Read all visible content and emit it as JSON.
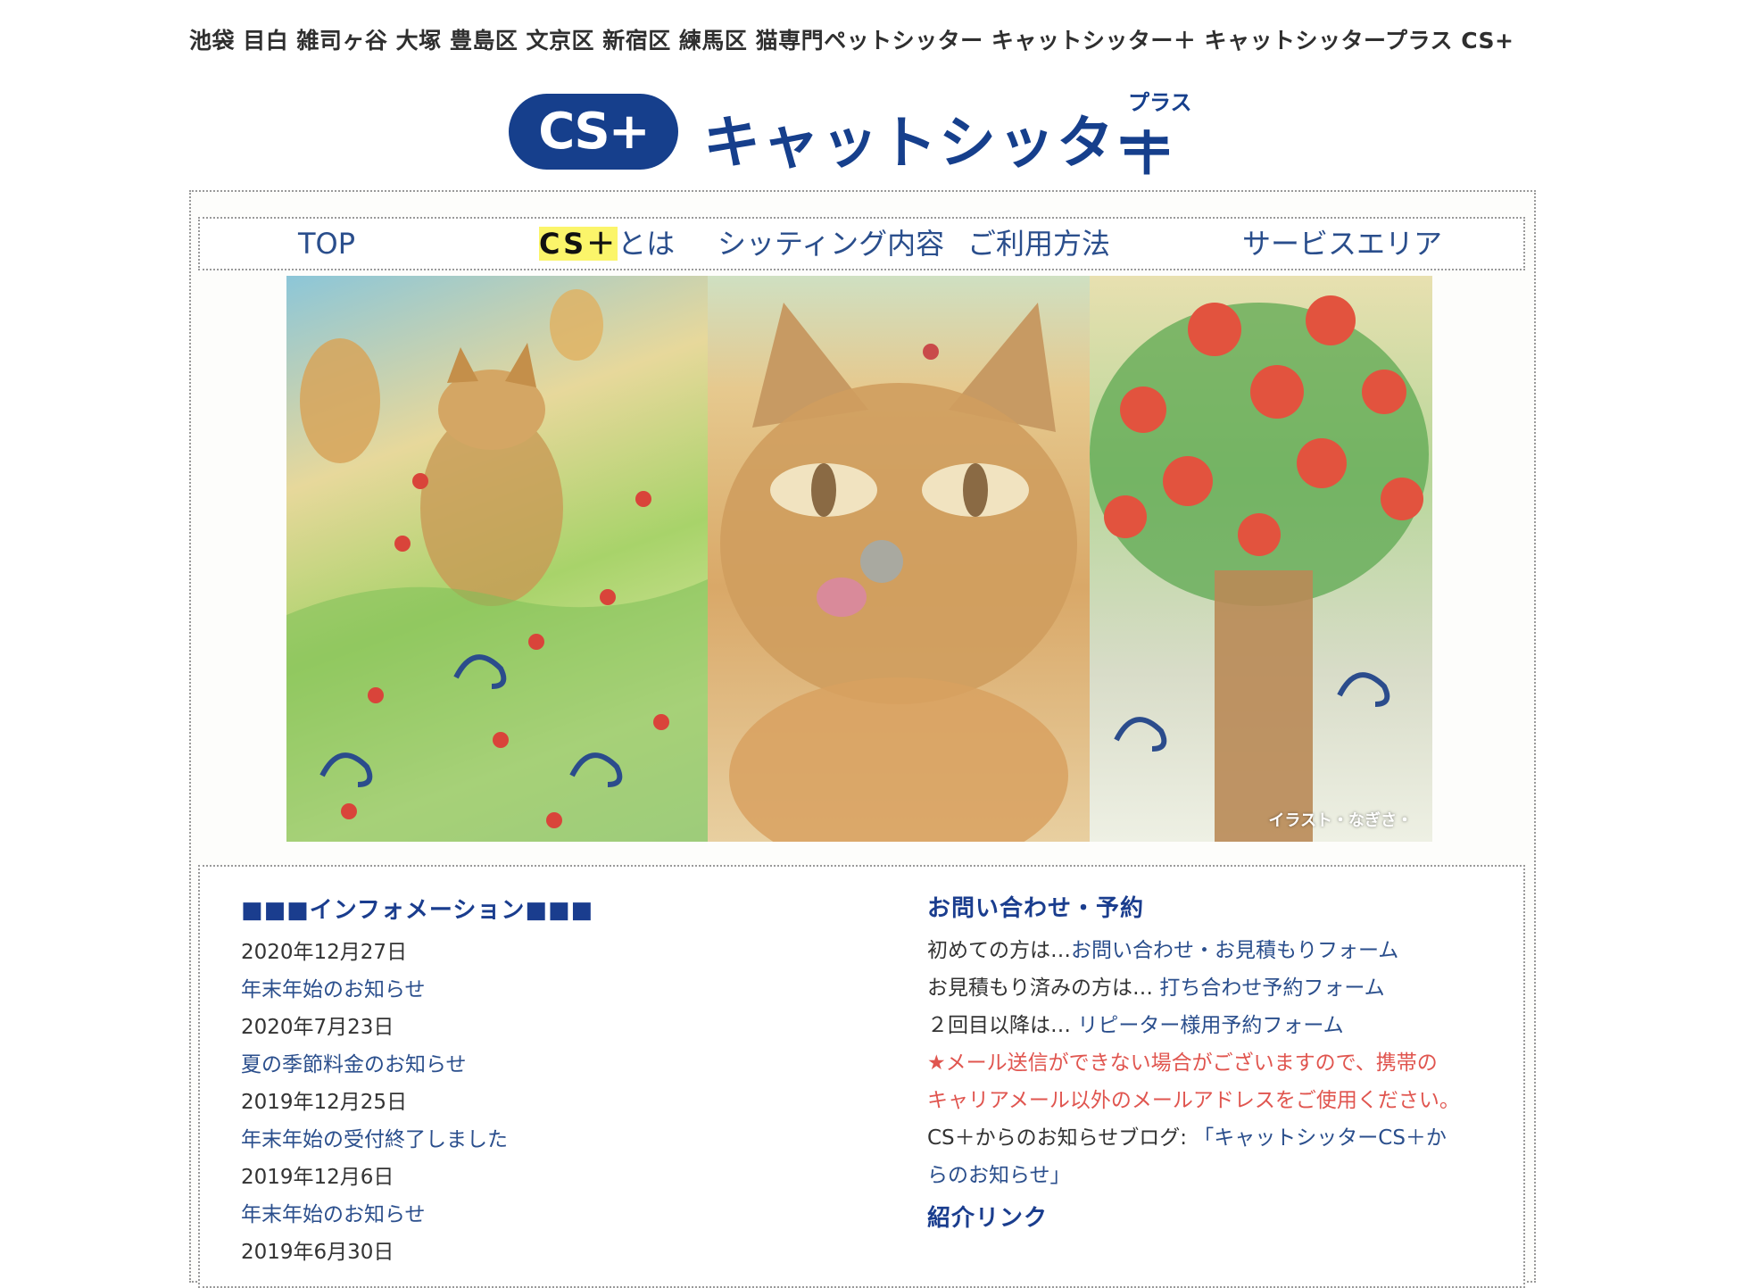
{
  "header": {
    "tagline": "池袋 目白 雑司ヶ谷 大塚 豊島区 文京区 新宿区 練馬区 猫専門ペットシッター キャットシッター＋ キャットシッタープラス CS+",
    "logo_mark": "CS+",
    "logo_text": "キャットシッター",
    "logo_plus": "＋",
    "logo_ruby": "プラス"
  },
  "nav": {
    "items": [
      {
        "label": "TOP"
      },
      {
        "label_hl": "CS＋",
        "label": "とは"
      },
      {
        "label": "シッティング内容"
      },
      {
        "label": "ご利用方法"
      },
      {
        "label": "サービスエリア"
      }
    ]
  },
  "hero": {
    "credit": "イラスト・なぎさ・"
  },
  "info": {
    "heading": "■■■インフォメーション■■■",
    "entries": [
      {
        "date": "2020年12月27日",
        "title": "年末年始のお知らせ"
      },
      {
        "date": "2020年7月23日",
        "title": "夏の季節料金のお知らせ"
      },
      {
        "date": "2019年12月25日",
        "title": "年末年始の受付終了しました"
      },
      {
        "date": "2019年12月6日",
        "title": "年末年始のお知らせ"
      },
      {
        "date": "2019年6月30日",
        "title": ""
      }
    ]
  },
  "contact": {
    "heading": "お問い合わせ・予約",
    "first_prefix": "初めての方は…",
    "first_link": "お問い合わせ・お見積もりフォーム",
    "estimated_prefix": "お見積もり済みの方は… ",
    "estimated_link": "打ち合わせ予約フォーム",
    "repeat_prefix": "２回目以降は… ",
    "repeat_link": "リピーター様用予約フォーム",
    "warning_line1": "★メール送信ができない場合がございますので、携帯の",
    "warning_line2": "キャリアメール以外のメールアドレスをご使用ください。",
    "blog_prefix": "CS＋からのお知らせブログ: ",
    "blog_link_line1": "「キャットシッターCS＋か",
    "blog_link_line2": "らのお知らせ」",
    "links_heading": "紹介リンク"
  },
  "colors": {
    "brand_blue": "#163f8c",
    "link_blue": "#2a4e8c",
    "warning_red": "#e0554f",
    "highlight_yellow": "#fbf56a"
  }
}
